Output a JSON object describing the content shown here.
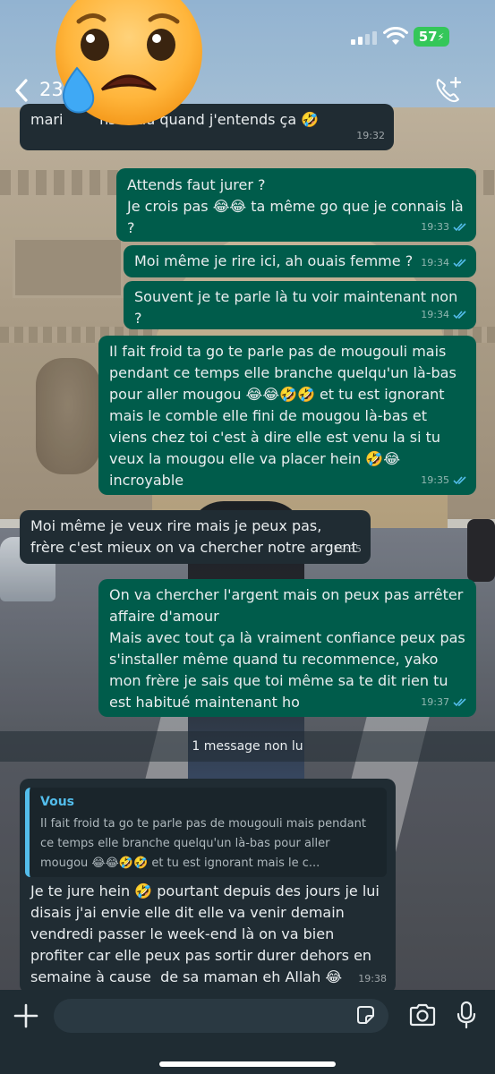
{
  "status_bar": {
    "battery": "57"
  },
  "header": {
    "back_count": "23"
  },
  "messages": [
    {
      "id": "m0",
      "dir": "in",
      "text": "mari        ns l'eau quand j'entends ça 🤣",
      "time": "19:32"
    },
    {
      "id": "m1",
      "dir": "out",
      "text": "Attends faut jurer ?\nJe crois pas 😂😂 ta même go que je connais là ?",
      "time": "19:33"
    },
    {
      "id": "m2",
      "dir": "out",
      "text": "Moi même je rire ici, ah ouais femme ?",
      "time": "19:34"
    },
    {
      "id": "m3",
      "dir": "out",
      "text": "Souvent je te parle là tu voir maintenant non ?",
      "time": "19:34"
    },
    {
      "id": "m4",
      "dir": "out",
      "text": "Il fait froid ta go te parle pas de mougouli mais pendant ce temps elle branche quelqu'un là-bas pour aller mougou 😂😂🤣🤣 et tu est ignorant mais le comble elle fini de mougou là-bas et viens chez toi c'est à dire elle est venu la si tu veux la mougou elle va placer hein 🤣😂 incroyable",
      "time": "19:35"
    },
    {
      "id": "m5",
      "dir": "in",
      "text": "Moi même je veux rire mais je peux pas, frère c'est mieux on va chercher notre argent",
      "time": "19:35"
    },
    {
      "id": "m6",
      "dir": "out",
      "text": "On va chercher l'argent mais on peux pas arrêter affaire d'amour\nMais avec tout ça là vraiment confiance peux pas s'installer même quand tu recommence, yako mon frère je sais que toi même sa te dit rien tu est habitué maintenant ho",
      "time": "19:37"
    },
    {
      "id": "m7",
      "dir": "in",
      "text": "Je te jure hein 🤣 pourtant depuis des jours je lui disais j'ai envie elle dit elle va venir demain vendredi passer le week-end là on va bien profiter car elle peux pas sortir durer dehors en semaine à cause  de sa maman eh Allah 😂",
      "time": "19:38"
    }
  ],
  "unread_banner": "1 message non lu",
  "quoted": {
    "author": "Vous",
    "text": "Il fait froid ta go te parle pas de mougouli mais pendant ce temps elle branche quelqu'un là-bas pour aller mougou 😂😂🤣🤣  et tu est ignorant mais le c..."
  },
  "input": {
    "value": ""
  },
  "icons": [
    "back-chevron-icon",
    "call-add-icon",
    "signal-icon",
    "wifi-icon",
    "battery-icon",
    "plus-icon",
    "sticker-icon",
    "camera-icon",
    "microphone-icon",
    "read-ticks-icon",
    "sad-emoji-icon"
  ],
  "colors": {
    "outgoing": "#005c4b",
    "incoming": "#202c33",
    "tick": "#53bdeb",
    "battery": "#34c759"
  }
}
